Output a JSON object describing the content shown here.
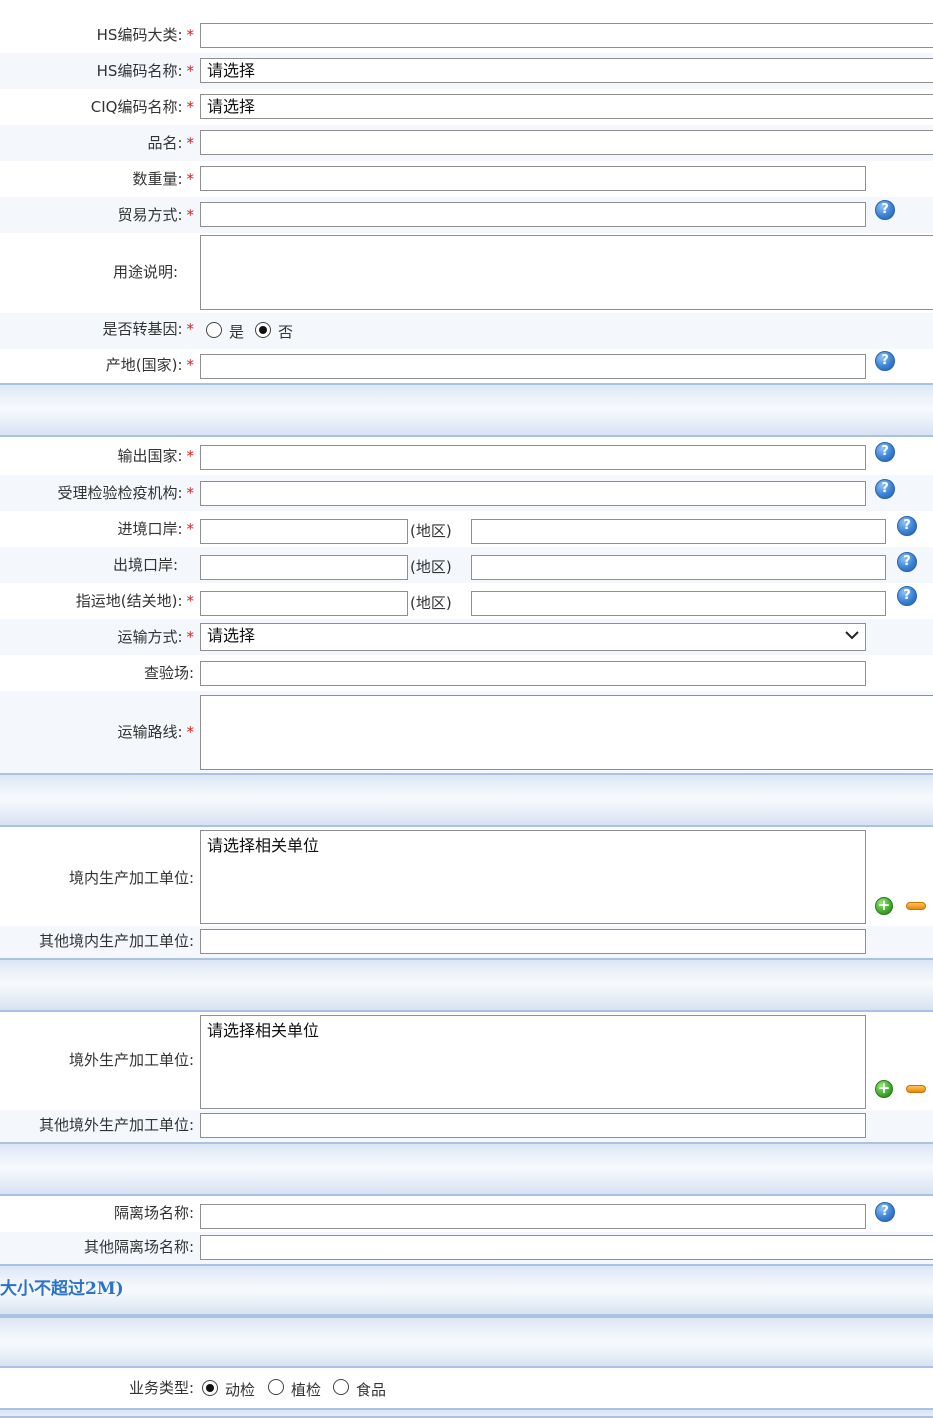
{
  "goods": {
    "hs_category": {
      "label": "HS编码大类:",
      "required": "*",
      "value": ""
    },
    "hs_name": {
      "label": "HS编码名称:",
      "required": "*",
      "value": "请选择"
    },
    "ciq_name": {
      "label": "CIQ编码名称:",
      "required": "*",
      "value": "请选择"
    },
    "product_name": {
      "label": "品名:",
      "required": "*",
      "value": ""
    },
    "quantity": {
      "label": "数重量:",
      "required": "*",
      "value": ""
    },
    "trade_mode": {
      "label": "贸易方式:",
      "required": "*",
      "value": "",
      "help": "?"
    },
    "usage": {
      "label": "用途说明:",
      "value": ""
    },
    "gmo": {
      "label": "是否转基因:",
      "required": "*",
      "options": [
        "是",
        "否"
      ],
      "selected": "否"
    },
    "origin": {
      "label": "产地(国家):",
      "required": "*",
      "value": "",
      "help": "?"
    }
  },
  "transport": {
    "export_country": {
      "label": "输出国家:",
      "required": "*",
      "value": "",
      "help": "?"
    },
    "inspection_org": {
      "label": "受理检验检疫机构:",
      "required": "*",
      "value": "",
      "help": "?"
    },
    "entry_port": {
      "label": "进境口岸:",
      "required": "*",
      "value": "",
      "region_label": "(地区)",
      "region_value": "",
      "help": "?"
    },
    "exit_port": {
      "label": "出境口岸:",
      "value": "",
      "region_label": "(地区)",
      "region_value": "",
      "help": "?"
    },
    "destination": {
      "label": "指运地(结关地):",
      "required": "*",
      "value": "",
      "region_label": "(地区)",
      "region_value": "",
      "help": "?"
    },
    "transport_mode": {
      "label": "运输方式:",
      "required": "*",
      "value": "请选择"
    },
    "inspection_site": {
      "label": "查验场:",
      "value": ""
    },
    "route": {
      "label": "运输路线:",
      "required": "*",
      "value": ""
    }
  },
  "domestic": {
    "units_label": "境内生产加工单位:",
    "units_placeholder": "请选择相关单位",
    "other_label": "其他境内生产加工单位:",
    "other_value": ""
  },
  "foreign": {
    "units_label": "境外生产加工单位:",
    "units_placeholder": "请选择相关单位",
    "other_label": "其他境外生产加工单位:",
    "other_value": ""
  },
  "quarantine": {
    "site": {
      "label": "隔离场名称:",
      "value": "",
      "help": "?"
    },
    "other": {
      "label": "其他隔离场名称:",
      "value": ""
    }
  },
  "notice": "大小不超过2M)",
  "business": {
    "label": "业务类型:",
    "options": [
      "动检",
      "植检",
      "食品"
    ],
    "selected": "动检"
  },
  "colors": {
    "required": "#d82020",
    "help_icon": "#3a82d6",
    "separator": "#a9c2e2",
    "notice": "#2a73c8"
  }
}
